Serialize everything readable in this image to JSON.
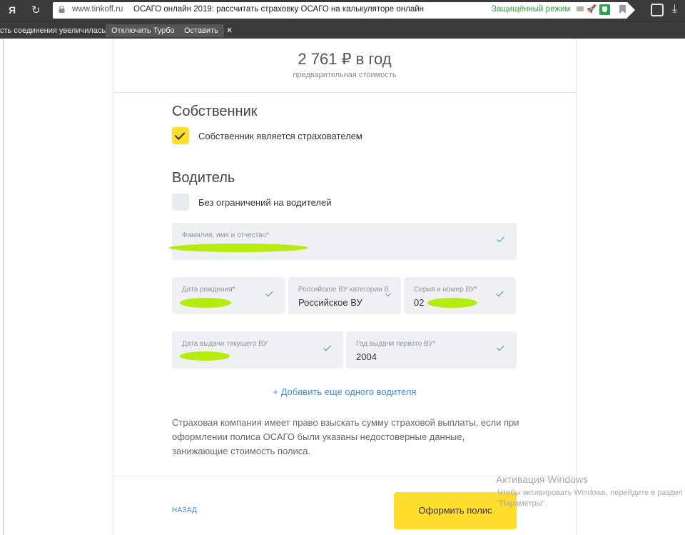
{
  "browser": {
    "logo": "Я",
    "reload_icon": "↻",
    "url_domain": "www.tinkoff.ru",
    "page_title": "ОСАГО онлайн 2019: рассчитать страховку ОСАГО на калькуляторе онлайн",
    "protected_mode": "Защищённый режим",
    "download_icon": "⤓",
    "rocket_icon": "🚀"
  },
  "turbo": {
    "message": "сть соединения увеличилась.",
    "disable_label": "Отключить Турбо",
    "keep_label": "Оставить",
    "close_label": "×"
  },
  "price": {
    "amount": "2 761 ₽ в год",
    "subtitle": "предварительная стоимость"
  },
  "owner": {
    "heading": "Собственник",
    "checkbox_label": "Собственник является страхователем",
    "checked": true
  },
  "driver": {
    "heading": "Водитель",
    "unlimited_label": "Без ограничений на водителей",
    "unlimited_checked": false,
    "full_name_label": "Фамилия, имя и отчество*",
    "birth_date_label": "Дата рождения*",
    "license_type_label": "Российское ВУ категории В",
    "license_type_value": "Российское ВУ",
    "license_number_label": "Серия и номер ВУ*",
    "license_number_value": "02",
    "issue_date_label": "Дата выдачи текущего ВУ",
    "first_license_year_label": "Год выдачи первого ВУ*",
    "first_license_year_value": "2004"
  },
  "add_driver_label": "+ Добавить еще одного водителя",
  "disclaimer": "Страховая компания имеет право взыскать сумму страховой выплаты, если при оформлении полиса ОСАГО были указаны недостоверные данные, занижающие стоимость полиса.",
  "footer": {
    "back_label": "НАЗАД",
    "submit_label": "Оформить полис"
  },
  "windows_activation": {
    "title": "Активация Windows",
    "text": "Чтобы активировать Windows, перейдите в раздел \"Параметры\"."
  },
  "colors": {
    "accent_yellow": "#ffdd2d",
    "link_blue": "#428bca",
    "check_green": "#35a852",
    "protected_green": "#2e9e3a",
    "redaction_green": "#b4ec0e"
  }
}
